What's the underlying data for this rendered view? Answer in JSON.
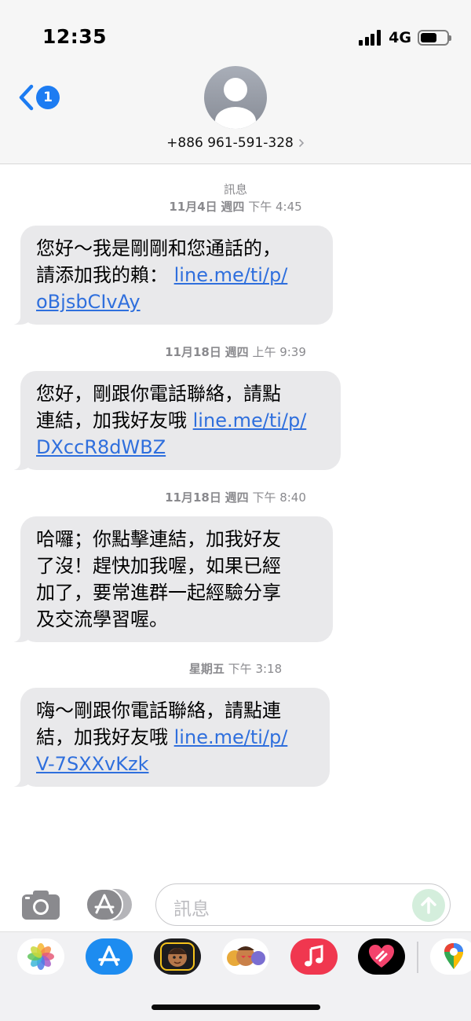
{
  "status_bar": {
    "time": "12:35",
    "network": "4G"
  },
  "nav": {
    "back_badge": "1",
    "contact": "+886 961-591-328"
  },
  "thread": {
    "service_label": "訊息",
    "messages": [
      {
        "date": "11月4日",
        "day": "週四",
        "time": "下午 4:45",
        "lines": [
          "您好～我是剛剛和您通話的，",
          "請添加我的賴：",
          "oBjsbCIvAy"
        ],
        "link_inline": "line.me/ti/p/"
      },
      {
        "date": "11月18日",
        "day": "週四",
        "time": "上午 9:39",
        "lines": [
          "您好，剛跟你電話聯絡，請點",
          "連結，加我好友哦",
          "DXccR8dWBZ"
        ],
        "link_inline": "line.me/ti/p/"
      },
      {
        "date": "11月18日",
        "day": "週四",
        "time": "下午 8:40",
        "lines": [
          "哈囉；你點擊連結，加我好友",
          "了沒！趕快加我喔，如果已經",
          "加了，要常進群一起經驗分享",
          "及交流學習喔。"
        ]
      },
      {
        "date": "",
        "day": "星期五",
        "time": "下午 3:18",
        "lines": [
          "嗨～剛跟你電話聯絡，請點連",
          "結，加我好友哦",
          "V-7SXXvKzk"
        ],
        "link_inline": "line.me/ti/p/"
      }
    ]
  },
  "composer": {
    "placeholder": "訊息"
  },
  "dock": {
    "apps": [
      "photos-icon",
      "app-store-icon",
      "memoji-icon",
      "animoji-icon",
      "music-icon",
      "digital-touch-icon",
      "maps-icon"
    ]
  },
  "colors": {
    "link": "#2f6fdd",
    "accent": "#1d7cf2",
    "bubble": "#e9e9eb"
  }
}
